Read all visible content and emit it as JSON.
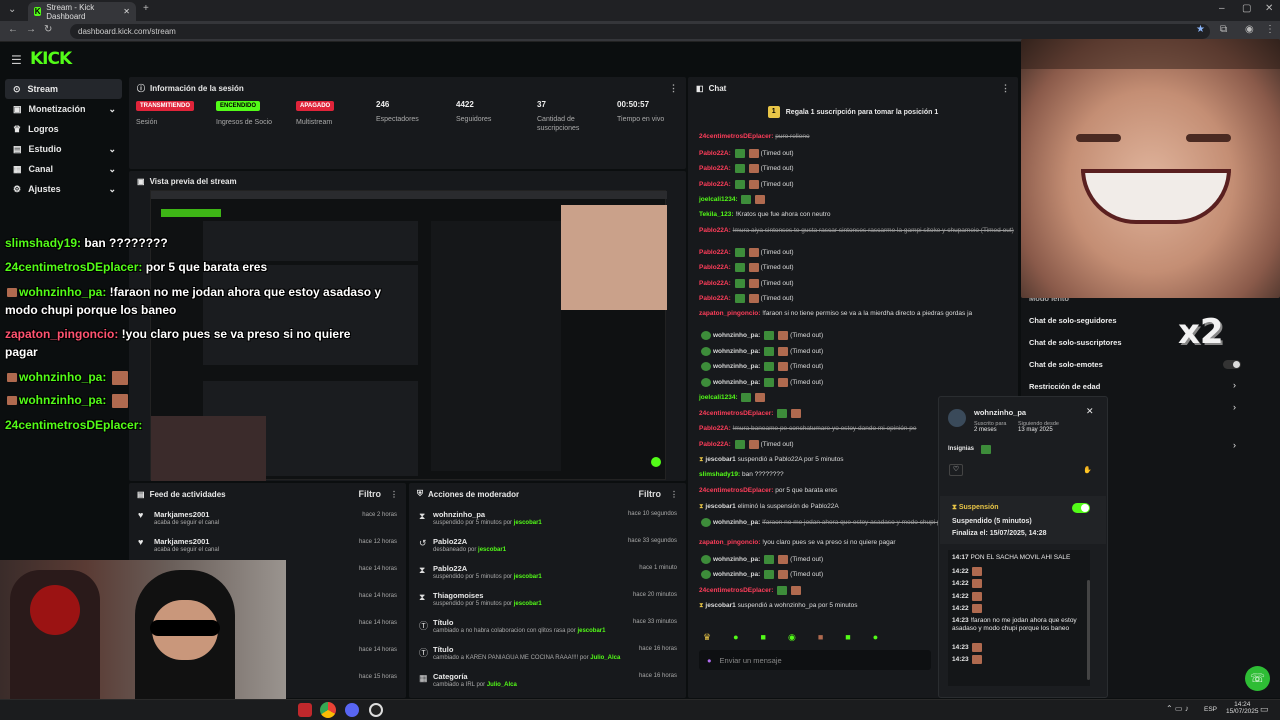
{
  "browser": {
    "tab_title": "Stream - Kick Dashboard",
    "url": "dashboard.kick.com/stream"
  },
  "header": {
    "logo": "KICK"
  },
  "sidebar": {
    "items": [
      {
        "label": "Stream",
        "icon": "broadcast-icon",
        "active": true
      },
      {
        "label": "Monetización",
        "icon": "money-icon",
        "chevron": true
      },
      {
        "label": "Logros",
        "icon": "trophy-icon"
      },
      {
        "label": "Estudio",
        "icon": "studio-icon",
        "chevron": true
      },
      {
        "label": "Canal",
        "icon": "channel-icon",
        "chevron": true
      },
      {
        "label": "Ajustes",
        "icon": "gear-icon",
        "chevron": true
      }
    ]
  },
  "session": {
    "title": "Información de la sesión",
    "stats": [
      {
        "badge": "TRANSMITIENDO",
        "label": "Sesión"
      },
      {
        "badge": "ENCENDIDO",
        "label": "Ingresos de Socio"
      },
      {
        "badge": "APAGADO",
        "label": "Multistream"
      },
      {
        "value": "246",
        "label": "Espectadores"
      },
      {
        "value": "4422",
        "label": "Seguidores"
      },
      {
        "value": "37",
        "label": "Cantidad de suscripciones"
      },
      {
        "value": "00:50:57",
        "label": "Tiempo en vivo"
      }
    ]
  },
  "preview": {
    "title": "Vista previa del stream"
  },
  "overlay_chat": [
    {
      "user": "slimshady19:",
      "msg": "ban ????????"
    },
    {
      "user": "24centimetrosDEplacer:",
      "msg": "por 5 que barata eres"
    },
    {
      "user": "wohnzinho_pa:",
      "msg": "!faraon no me jodan ahora que estoy asadaso y modo chupi porque los baneo"
    },
    {
      "user": "zapaton_pingoncio:",
      "msg": "!you claro pues se va preso si no quiere pagar"
    },
    {
      "user": "wohnzinho_pa:",
      "msg": ""
    },
    {
      "user": "wohnzinho_pa:",
      "msg": ""
    },
    {
      "user": "24centimetrosDEplacer:",
      "msg": ""
    }
  ],
  "feed": {
    "title": "Feed de actividades",
    "filter": "Filtro",
    "rows": [
      {
        "name": "Markjames2001",
        "sub": "acaba de seguir el canal",
        "time": "hace 2 horas"
      },
      {
        "name": "Markjames2001",
        "sub": "acaba de seguir el canal",
        "time": "hace 12 horas"
      },
      {
        "time": "hace 14 horas"
      },
      {
        "time": "hace 14 horas"
      },
      {
        "time": "hace 14 horas"
      },
      {
        "time": "hace 14 horas"
      },
      {
        "time": "hace 15 horas"
      }
    ]
  },
  "mod": {
    "title": "Acciones de moderador",
    "filter": "Filtro",
    "rows": [
      {
        "icon": "hourglass-icon",
        "name": "wohnzinho_pa",
        "sub": "suspendido por 5 minutos por",
        "by": "jescobar1",
        "time": "hace 10 segundos"
      },
      {
        "icon": "undo-icon",
        "name": "Pablo22A",
        "sub": "desbaneado por",
        "by": "jescobar1",
        "time": "hace 33 segundos"
      },
      {
        "icon": "hourglass-icon",
        "name": "Pablo22A",
        "sub": "suspendido por 5 minutos por",
        "by": "jescobar1",
        "time": "hace 1 minuto"
      },
      {
        "icon": "hourglass-icon",
        "name": "Thiagomoises",
        "sub": "suspendido por 5 minutos por",
        "by": "jescobar1",
        "time": "hace 20 minutos"
      },
      {
        "icon": "title-icon",
        "name": "Título",
        "sub": "cambiado a no habra colaboracion con qlitos rasa por",
        "by": "jescobar1",
        "time": "hace 33 minutos"
      },
      {
        "icon": "title-icon",
        "name": "Título",
        "sub": "cambiado a KAREN PANIAGUA ME COCINA RAAA!!!! por",
        "by": "Julio_Alca",
        "time": "hace 16 horas"
      },
      {
        "icon": "category-icon",
        "name": "Categoría",
        "sub": "cambiado a IRL por",
        "by": "Julio_Alca",
        "time": "hace 16 horas"
      }
    ]
  },
  "chat": {
    "title": "Chat",
    "pinned": "Regala 1 suscripción para tomar la posición 1",
    "pinned_rank": "1",
    "input_placeholder": "Enviar un mensaje",
    "lines": [
      {
        "user": "24centimetrosDEplacer:",
        "cls": "r",
        "msg": "puro relleno",
        "strike": true
      },
      {
        "user": "Pablo22A:",
        "cls": "r",
        "msg": "(Timed out)",
        "emote": true
      },
      {
        "user": "Pablo22A:",
        "cls": "r",
        "msg": "(Timed out)",
        "emote": true
      },
      {
        "user": "Pablo22A:",
        "cls": "r",
        "msg": "(Timed out)",
        "emote": true
      },
      {
        "user": "joelcali1234:",
        "cls": "g",
        "msg": "",
        "emote": true
      },
      {
        "user": "Tekila_123:",
        "cls": "g",
        "msg": "!Kratos que fue ahora con neutro"
      },
      {
        "user": "Pablo22A:",
        "cls": "r",
        "msg": "!mura aiya sintonses te gusta rascar sintonses rascarme la gampi sitoke y chupameio (Timed out)",
        "strike": true
      },
      {
        "user": "Pablo22A:",
        "cls": "r",
        "msg": "(Timed out)",
        "emote": true
      },
      {
        "user": "Pablo22A:",
        "cls": "r",
        "msg": "(Timed out)",
        "emote": true
      },
      {
        "user": "Pablo22A:",
        "cls": "r",
        "msg": "(Timed out)",
        "emote": true
      },
      {
        "user": "Pablo22A:",
        "cls": "r",
        "msg": "(Timed out)",
        "emote": true
      },
      {
        "user": "zapaton_pingoncio:",
        "cls": "r",
        "msg": "!faraon si no tiene permiso se va a la mierdha directo a piedras gordas ja"
      },
      {
        "user": "wohnzinho_pa:",
        "cls": "",
        "msg": "(Timed out)",
        "emote": true
      },
      {
        "user": "wohnzinho_pa:",
        "cls": "",
        "msg": "(Timed out)",
        "emote": true
      },
      {
        "user": "wohnzinho_pa:",
        "cls": "",
        "msg": "(Timed out)",
        "emote": true
      },
      {
        "user": "wohnzinho_pa:",
        "cls": "",
        "msg": "(Timed out)",
        "emote": true
      },
      {
        "user": "joelcali1234:",
        "cls": "g",
        "msg": "",
        "emote": true
      },
      {
        "user": "24centimetrosDEplacer:",
        "cls": "r",
        "msg": "",
        "emote": true
      },
      {
        "user": "Pablo22A:",
        "cls": "r",
        "msg": "!mura baneame pe conchatumare yo estoy dando mi opinión pe",
        "strike": true
      },
      {
        "user": "Pablo22A:",
        "cls": "r",
        "msg": "(Timed out)",
        "emote": true
      },
      {
        "user": "jescobar1",
        "cls": "sys",
        "msg": "suspendió a Pablo22A por 5 minutos"
      },
      {
        "user": "slimshady19:",
        "cls": "g",
        "msg": "ban ????????"
      },
      {
        "user": "24centimetrosDEplacer:",
        "cls": "r",
        "msg": "por 5 que barata eres"
      },
      {
        "user": "jescobar1",
        "cls": "sys",
        "msg": "eliminó la suspensión de Pablo22A"
      },
      {
        "user": "wohnzinho_pa:",
        "cls": "",
        "msg": "!faraon no me jodan ahora que estoy asadaso y modo chupi porque los baneo",
        "strike": true
      },
      {
        "user": "zapaton_pingoncio:",
        "cls": "r",
        "msg": "!you claro pues se va preso si no quiere pagar"
      },
      {
        "user": "wohnzinho_pa:",
        "cls": "",
        "msg": "(Timed out)",
        "emote": true
      },
      {
        "user": "wohnzinho_pa:",
        "cls": "",
        "msg": "(Timed out)",
        "emote": true
      },
      {
        "user": "24centimetrosDEplacer:",
        "cls": "r",
        "msg": "",
        "emote": true
      },
      {
        "user": "jescobar1",
        "cls": "sys",
        "msg": "suspendió a wohnzinho_pa por 5 minutos"
      }
    ]
  },
  "settings": {
    "options": [
      {
        "label": "Modo lento"
      },
      {
        "label": "Chat de solo-seguidores"
      },
      {
        "label": "Chat de solo-suscriptores"
      },
      {
        "label": "Chat de solo-emotes"
      },
      {
        "label": "Restricción de edad"
      }
    ]
  },
  "user_card": {
    "username": "wohnzinho_pa",
    "sub_label": "Suscrito para",
    "sub_value": "2 meses",
    "follow_label": "Siguiendo desde",
    "follow_value": "13 may 2025",
    "badges_label": "Insignias",
    "suspension_title": "Suspensión",
    "suspension_status": "Suspendido (5 minutos)",
    "suspension_end": "Finaliza el: 15/07/2025, 14:28",
    "history": [
      {
        "time": "14:17",
        "msg": "PON EL SACHA MOVIL AHI SALE"
      },
      {
        "time": "14:22",
        "msg": ""
      },
      {
        "time": "14:22",
        "msg": ""
      },
      {
        "time": "14:22",
        "msg": ""
      },
      {
        "time": "14:22",
        "msg": ""
      },
      {
        "time": "14:23",
        "msg": "!faraon no me jodan ahora que estoy asadaso y modo chupi porque los baneo"
      },
      {
        "time": "14:23",
        "msg": ""
      },
      {
        "time": "14:23",
        "msg": ""
      }
    ]
  },
  "overlay": {
    "multiplier": "x2"
  },
  "taskbar": {
    "lang": "ESP",
    "time": "14:24",
    "date": "15/07/2025"
  }
}
